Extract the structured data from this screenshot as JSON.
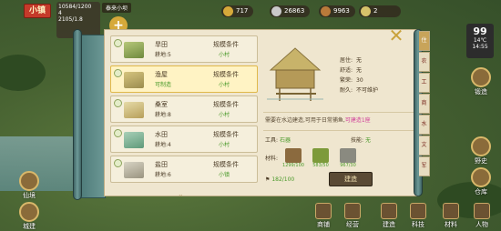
{
  "hud": {
    "city_label": "小镇",
    "city_stat_1": "10584/1200",
    "city_stat_2": "4",
    "city_stat_3": "2105/1.8",
    "village_name": "泰来小坝",
    "resources": [
      {
        "value": "717",
        "icon": "coin-icon",
        "color": "#d6a93a"
      },
      {
        "value": "26863",
        "icon": "population-icon",
        "color": "#c9c9c9"
      },
      {
        "value": "9963",
        "icon": "copper-icon",
        "color": "#b97a3a"
      },
      {
        "value": "2",
        "icon": "scroll-icon",
        "color": "#d6c26a"
      }
    ],
    "add_label": "+"
  },
  "weather": {
    "value": "99",
    "season": "14℃",
    "time": "14:55"
  },
  "side_right": [
    {
      "label": "锻造",
      "icon": "anvil-icon"
    },
    {
      "label": "野史",
      "icon": "book-icon"
    },
    {
      "label": "仓库",
      "icon": "warehouse-icon"
    }
  ],
  "side_left": [
    {
      "label": "仙境",
      "icon": "immortal-icon"
    },
    {
      "label": "城建",
      "icon": "build-icon"
    }
  ],
  "bottom_bar": [
    {
      "label": "商铺",
      "icon": "shop-icon"
    },
    {
      "label": "经营",
      "icon": "manage-icon"
    },
    {
      "label": "建造",
      "icon": "construct-icon"
    },
    {
      "label": "科技",
      "icon": "tech-icon"
    },
    {
      "label": "材料",
      "icon": "material-icon"
    },
    {
      "label": "人物",
      "icon": "people-icon"
    }
  ],
  "list": {
    "items": [
      {
        "name": "旱田",
        "sub": "耕地:5",
        "cond": "规模条件",
        "cond_value": "小村",
        "selected": false
      },
      {
        "name": "渔屋",
        "sub": "可制造",
        "cond": "规模条件",
        "cond_value": "小村",
        "selected": true
      },
      {
        "name": "桑室",
        "sub": "耕地:8",
        "cond": "规模条件",
        "cond_value": "小村",
        "selected": false
      },
      {
        "name": "水田",
        "sub": "耕地:4",
        "cond": "规模条件",
        "cond_value": "小村",
        "selected": false
      },
      {
        "name": "盐田",
        "sub": "耕地:6",
        "cond": "规模条件",
        "cond_value": "小镇",
        "selected": false
      }
    ],
    "more": "⌄"
  },
  "detail": {
    "stats": [
      {
        "label": "居住:",
        "value": "无"
      },
      {
        "label": "舒适:",
        "value": "无"
      },
      {
        "label": "繁荣:",
        "value": "30"
      },
      {
        "label": "耐久:",
        "value": "不可维护"
      }
    ],
    "description": "需要在水边建造,可用于日常捕鱼,",
    "description_highlight": "可建造1座",
    "tool_label": "工具:",
    "tool_value": "石器",
    "skill_label": "技能:",
    "skill_value": "无",
    "material_label": "材料:",
    "materials": [
      {
        "count": "1299/100",
        "icon": "wood-icon",
        "color": "#8b6a3e"
      },
      {
        "count": "583/50",
        "icon": "bamboo-icon",
        "color": "#7d9a3a"
      },
      {
        "count": "967/30",
        "icon": "stone-icon",
        "color": "#8a8a80"
      }
    ],
    "pop_label": "⚑",
    "pop_value": "182/100",
    "build_button": "建造"
  },
  "tabs": [
    "住",
    "农",
    "工",
    "商",
    "水",
    "文",
    "军"
  ],
  "close": "✕"
}
